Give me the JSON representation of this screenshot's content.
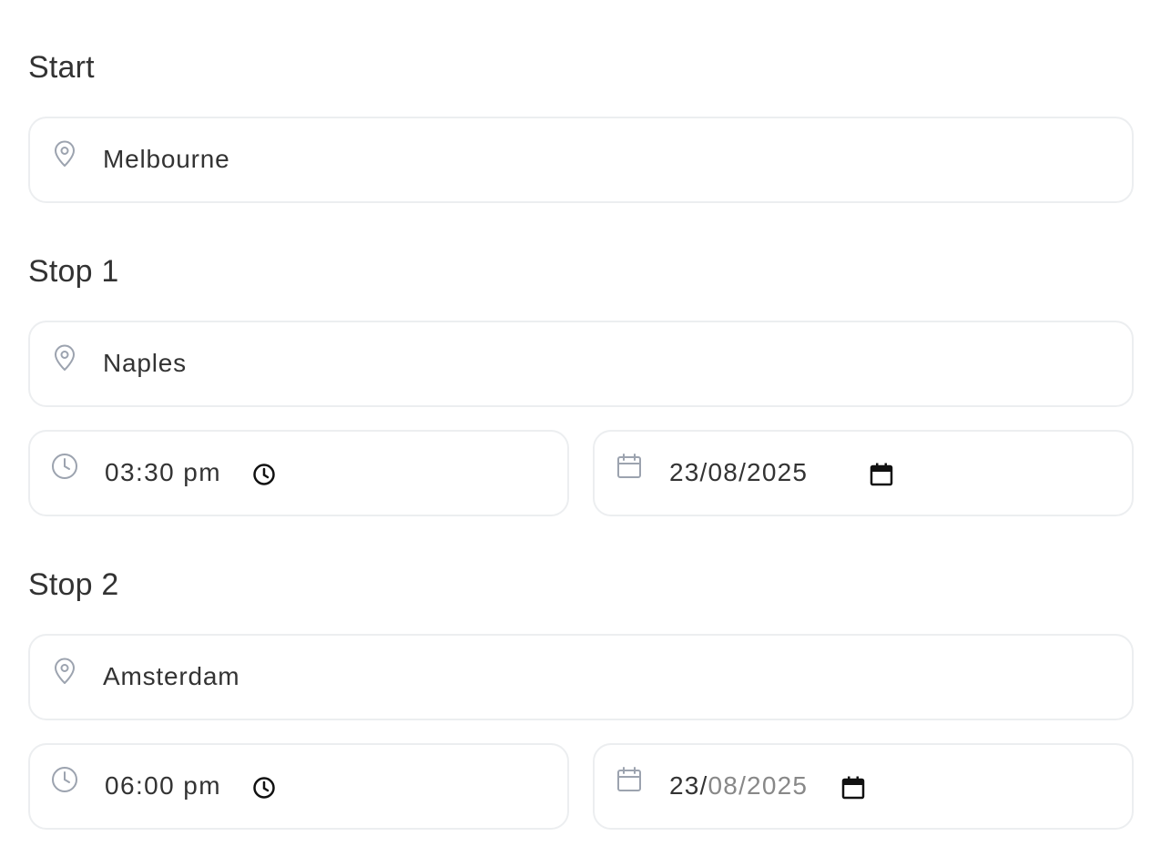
{
  "start": {
    "title": "Start",
    "location": "Melbourne"
  },
  "stop1": {
    "title": "Stop 1",
    "location": "Naples",
    "time": "03:30 pm",
    "date": "23/08/2025"
  },
  "stop2": {
    "title": "Stop 2",
    "location": "Amsterdam",
    "time": "06:00 pm",
    "date_day": "23/",
    "date_rest": "08/2025"
  },
  "icons": {
    "location": "map-pin-icon",
    "time": "clock-icon",
    "date": "calendar-icon",
    "time_picker": "clock-picker-icon",
    "date_picker": "calendar-picker-icon"
  },
  "colors": {
    "text": "#333333",
    "icon": "#9ca3af",
    "border": "#eceef0",
    "placeholder": "#888888"
  }
}
